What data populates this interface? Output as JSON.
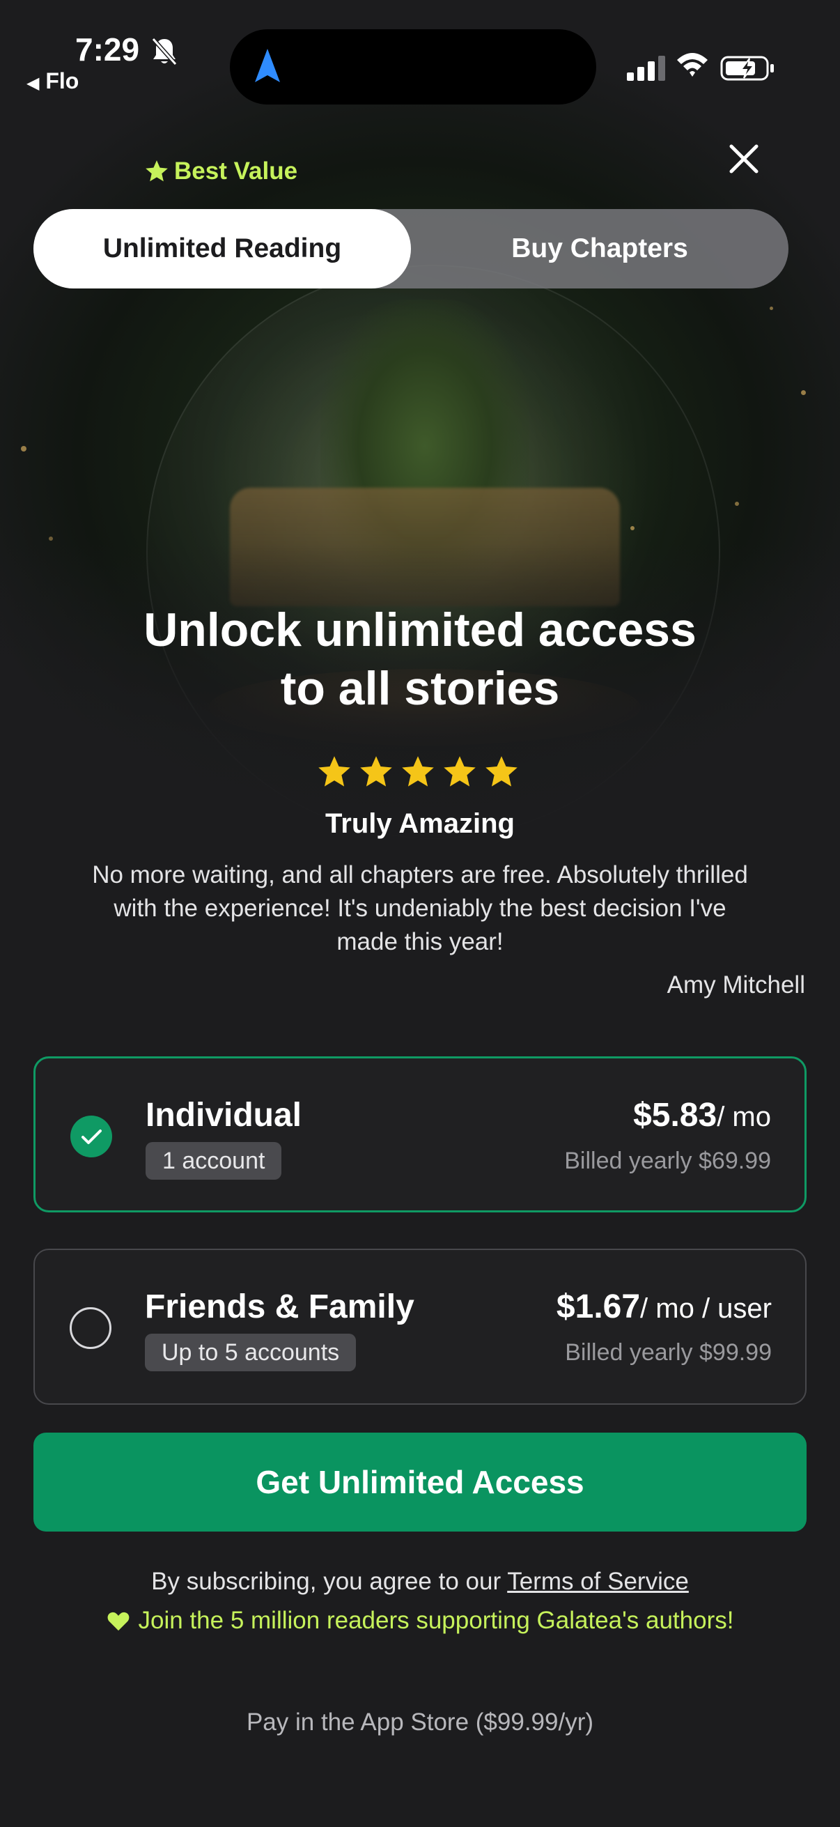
{
  "status_bar": {
    "time": "7:29",
    "back_app": "Flo"
  },
  "tabs": {
    "badge": "Best Value",
    "items": [
      {
        "label": "Unlimited Reading",
        "active": true
      },
      {
        "label": "Buy Chapters",
        "active": false
      }
    ]
  },
  "hero": {
    "headline_line1": "Unlock unlimited access",
    "headline_line2": "to all stories"
  },
  "review": {
    "rating": 5,
    "title": "Truly Amazing",
    "text": "No more waiting, and all chapters are free. Absolutely thrilled with the experience! It's undeniably the best decision I've made this year!",
    "author": "Amy Mitchell"
  },
  "plans": [
    {
      "name": "Individual",
      "badge": "1 account",
      "price": "$5.83",
      "unit": "/ mo",
      "billed": "Billed yearly $69.99",
      "selected": true
    },
    {
      "name": "Friends & Family",
      "badge": "Up to 5 accounts",
      "price": "$1.67",
      "unit": "/ mo / user",
      "billed": "Billed yearly $99.99",
      "selected": false
    }
  ],
  "cta": {
    "label": "Get Unlimited Access"
  },
  "footer": {
    "agree_prefix": "By subscribing, you agree to our ",
    "terms_link": "Terms of Service",
    "join_text": "Join the 5 million readers supporting Galatea's authors!",
    "pay_store": "Pay in the App Store ($99.99/yr)"
  },
  "colors": {
    "accent_green": "#0a9460",
    "highlight_lime": "#c6f25b",
    "star_gold": "#f5c518",
    "background": "#1c1c1e"
  },
  "icons": [
    "bell-slash-icon",
    "navigation-arrow-icon",
    "signal-icon",
    "wifi-icon",
    "battery-charging-icon",
    "close-icon",
    "star-icon",
    "checkmark-icon",
    "heart-icon"
  ]
}
